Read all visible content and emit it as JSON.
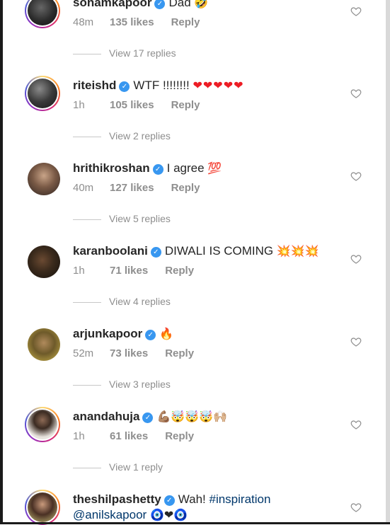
{
  "comments": [
    {
      "username": "sonamkapoor",
      "text": "Dad",
      "emoji": "🤣",
      "time": "48m",
      "likes": "135 likes",
      "reply": "Reply",
      "view_replies": "View 17 replies"
    },
    {
      "username": "riteishd",
      "text": "WTF !!!!!!!!",
      "emoji": "❤❤❤❤❤",
      "time": "1h",
      "likes": "105 likes",
      "reply": "Reply",
      "view_replies": "View 2 replies"
    },
    {
      "username": "hrithikroshan",
      "text": "I agree",
      "emoji": "💯",
      "time": "40m",
      "likes": "127 likes",
      "reply": "Reply",
      "view_replies": "View 5 replies"
    },
    {
      "username": "karanboolani",
      "text": "DIWALI IS COMING",
      "emoji": "💥💥💥",
      "time": "1h",
      "likes": "71 likes",
      "reply": "Reply",
      "view_replies": "View 4 replies"
    },
    {
      "username": "arjunkapoor",
      "text": "",
      "emoji": "🔥",
      "time": "52m",
      "likes": "73 likes",
      "reply": "Reply",
      "view_replies": "View 3 replies"
    },
    {
      "username": "anandahuja",
      "text": "",
      "emoji": "💪🏽🤯🤯🤯🙌🏼",
      "time": "1h",
      "likes": "61 likes",
      "reply": "Reply",
      "view_replies": "View 1 reply"
    },
    {
      "username": "theshilpashetty",
      "text": "Wah!",
      "hashtag": "#inspiration",
      "mention": "@anilskapoor",
      "emoji": "🧿❤🧿"
    }
  ],
  "colors": {
    "verified": "#3897f0",
    "meta_text": "#8e8e8e",
    "mention": "#00376b",
    "emoji_heart": "#ed1c24"
  }
}
